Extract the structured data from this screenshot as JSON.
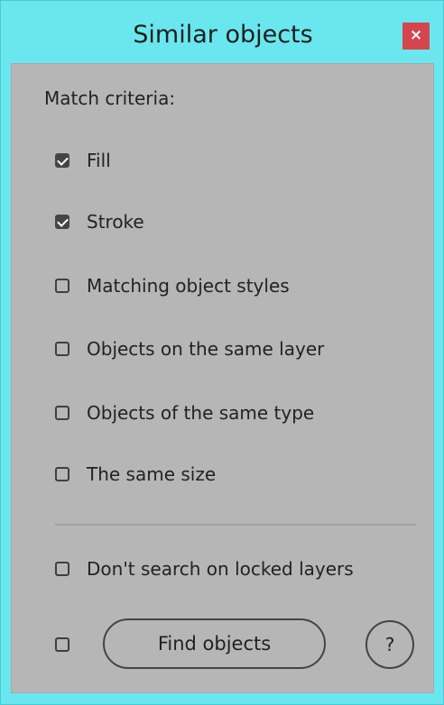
{
  "window": {
    "title": "Similar objects",
    "close_label": "×"
  },
  "criteria": {
    "heading": "Match criteria:",
    "items": [
      {
        "label": "Fill",
        "checked": true
      },
      {
        "label": "Stroke",
        "checked": true
      },
      {
        "label": "Matching object styles",
        "checked": false
      },
      {
        "label": "Objects on the same layer",
        "checked": false
      },
      {
        "label": "Objects of the same type",
        "checked": false
      },
      {
        "label": "The same size",
        "checked": false
      }
    ]
  },
  "options": {
    "locked_label": "Don't search on locked layers",
    "locked_checked": false,
    "bottom_checked": false
  },
  "actions": {
    "find_label": "Find objects",
    "help_label": "?"
  },
  "colors": {
    "title_bar": "#6ae7ee",
    "panel": "#b6b6b6",
    "close": "#d6454f"
  }
}
